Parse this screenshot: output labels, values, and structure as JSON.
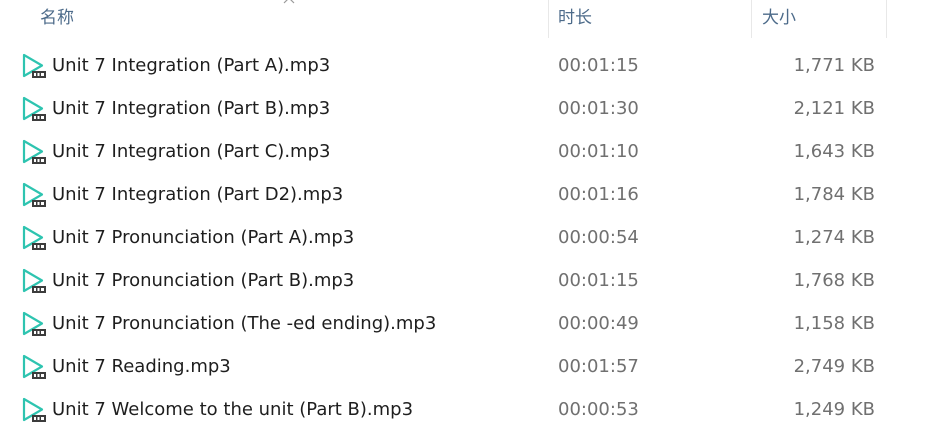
{
  "columns": {
    "name": "名称",
    "duration": "时长",
    "size": "大小"
  },
  "files": [
    {
      "name": "Unit 7 Integration (Part A).mp3",
      "duration": "00:01:15",
      "size": "1,771 KB"
    },
    {
      "name": "Unit 7 Integration (Part B).mp3",
      "duration": "00:01:30",
      "size": "2,121 KB"
    },
    {
      "name": "Unit 7 Integration (Part C).mp3",
      "duration": "00:01:10",
      "size": "1,643 KB"
    },
    {
      "name": "Unit 7 Integration (Part D2).mp3",
      "duration": "00:01:16",
      "size": "1,784 KB"
    },
    {
      "name": "Unit 7 Pronunciation (Part A).mp3",
      "duration": "00:00:54",
      "size": "1,274 KB"
    },
    {
      "name": "Unit 7 Pronunciation (Part B).mp3",
      "duration": "00:01:15",
      "size": "1,768 KB"
    },
    {
      "name": "Unit 7 Pronunciation (The -ed ending).mp3",
      "duration": "00:00:49",
      "size": "1,158 KB"
    },
    {
      "name": "Unit 7 Reading.mp3",
      "duration": "00:01:57",
      "size": "2,749 KB"
    },
    {
      "name": "Unit 7 Welcome to the unit (Part B).mp3",
      "duration": "00:00:53",
      "size": "1,249 KB"
    }
  ],
  "icons": {
    "file_type": "mp3-file-icon",
    "sort": "chevron-up-icon"
  },
  "colors": {
    "icon_accent": "#2ec4b0",
    "header_text": "#4d6b8a",
    "name_text": "#1e1e1e",
    "meta_text": "#707070"
  }
}
